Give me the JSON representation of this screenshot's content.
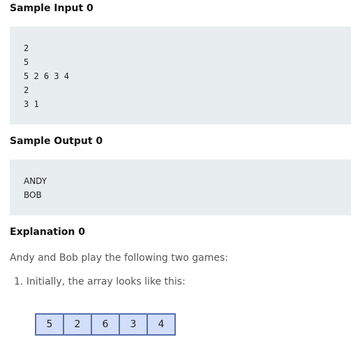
{
  "sample_input": {
    "heading": "Sample Input 0",
    "lines": [
      "2",
      "5",
      "5 2 6 3 4",
      "2",
      "3 1"
    ]
  },
  "sample_output": {
    "heading": "Sample Output 0",
    "lines": [
      "ANDY",
      "BOB"
    ]
  },
  "explanation": {
    "heading": "Explanation 0",
    "intro": "Andy and Bob play the following two games:",
    "step_1": "1. Initially, the array looks like this:",
    "array": [
      "5",
      "2",
      "6",
      "3",
      "4"
    ]
  },
  "colors": {
    "code_background": "#e8eeef",
    "array_fill": "#d3defa",
    "array_border": "#5670b0"
  }
}
